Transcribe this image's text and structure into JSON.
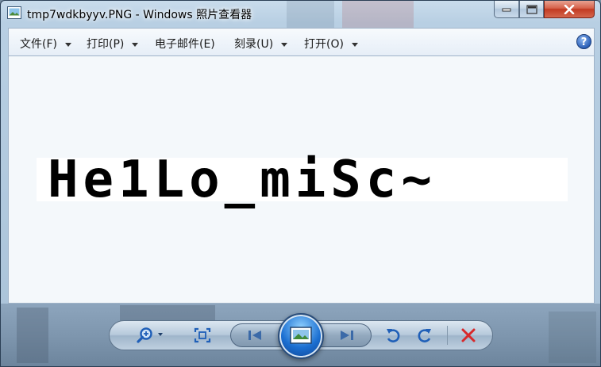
{
  "window": {
    "title": "tmp7wdkbyyv.PNG - Windows 照片查看器"
  },
  "menu": {
    "items": [
      {
        "label": "文件(F)",
        "has_arrow": true
      },
      {
        "label": "打印(P)",
        "has_arrow": true
      },
      {
        "label": "电子邮件(E)",
        "has_arrow": false
      },
      {
        "label": "刻录(U)",
        "has_arrow": true
      },
      {
        "label": "打开(O)",
        "has_arrow": true
      }
    ],
    "help_glyph": "?"
  },
  "image": {
    "text": "He1Lo_miSc~"
  },
  "controls": {
    "icons": [
      "zoom-icon",
      "fit-to-window-icon",
      "previous-icon",
      "slideshow-icon",
      "next-icon",
      "rotate-counterclockwise-icon",
      "rotate-clockwise-icon",
      "delete-icon"
    ]
  },
  "colors": {
    "close_button": "#c9412a",
    "delete_icon": "#d8282a",
    "slideshow_button": "#1b6fd1",
    "rotate_icons": "#1f5fb8"
  }
}
